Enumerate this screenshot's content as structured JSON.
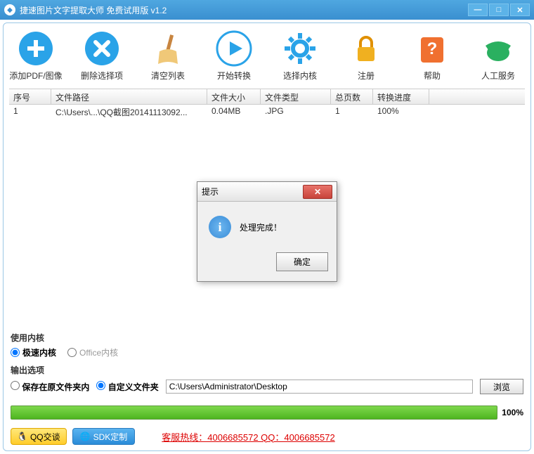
{
  "window": {
    "title": "捷速图片文字提取大师 免费试用版 v1.2"
  },
  "toolbar": {
    "add": "添加PDF/图像",
    "delete": "删除选择项",
    "clear": "清空列表",
    "start": "开始转换",
    "kernel": "选择内核",
    "register": "注册",
    "help": "帮助",
    "service": "人工服务"
  },
  "table": {
    "headers": {
      "seq": "序号",
      "path": "文件路径",
      "size": "文件大小",
      "type": "文件类型",
      "pages": "总页数",
      "progress": "转换进度"
    },
    "rows": [
      {
        "seq": "1",
        "path": "C:\\Users\\...\\QQ截图20141113092...",
        "size": "0.04MB",
        "type": ".JPG",
        "pages": "1",
        "progress": "100%"
      }
    ]
  },
  "kernel_section": {
    "label": "使用内核",
    "option_fast": "极速内核",
    "option_office": "Office内核"
  },
  "output_section": {
    "label": "输出选项",
    "option_same": "保存在原文件夹内",
    "option_custom": "自定义文件夹",
    "path_value": "C:\\Users\\Administrator\\Desktop",
    "browse": "浏览"
  },
  "progress": {
    "text": "100%"
  },
  "footer": {
    "qq": "QQ交谈",
    "sdk": "SDK定制",
    "hotline": "客服热线：4006685572 QQ：4006685572"
  },
  "dialog": {
    "title": "提示",
    "message": "处理完成！",
    "ok": "确定"
  }
}
